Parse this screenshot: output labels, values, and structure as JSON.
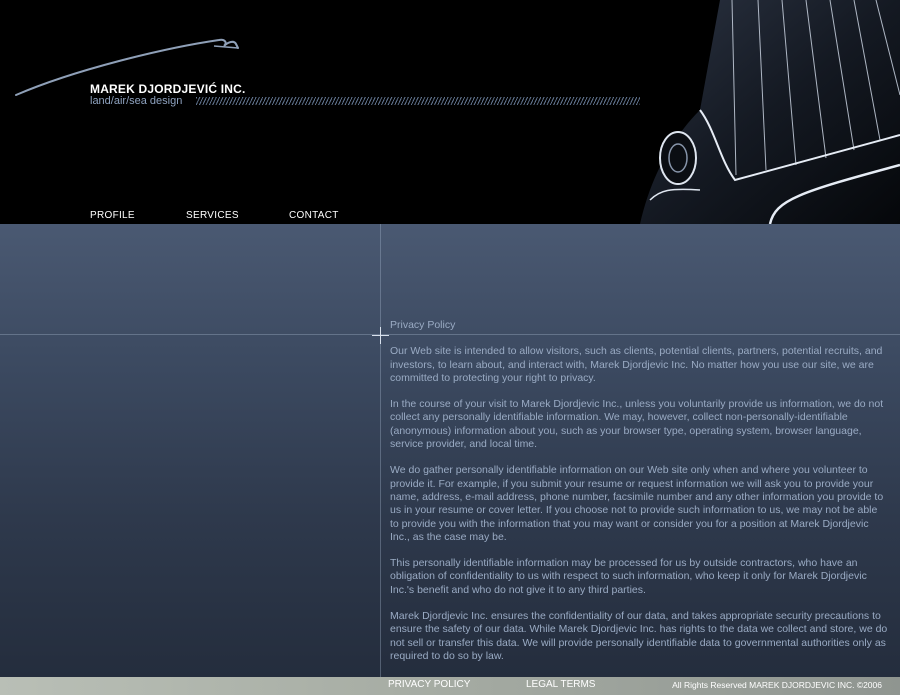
{
  "brand": {
    "name": "MAREK DJORDJEVIĆ INC.",
    "tagline": "land/air/sea design"
  },
  "nav": {
    "items": [
      {
        "label": "PROFILE"
      },
      {
        "label": "SERVICES"
      },
      {
        "label": "CONTACT"
      }
    ]
  },
  "privacy": {
    "title": "Privacy Policy",
    "paragraphs": [
      "Our Web site is intended to allow visitors, such as clients, potential clients, partners, potential recruits, and investors, to learn about, and interact with, Marek Djordjevic Inc. No matter how you use our site, we are committed to protecting your right to privacy.",
      "In the course of your visit to Marek Djordjevic Inc., unless you voluntarily provide us information, we do not collect any personally identifiable information. We may, however, collect non-personally-identifiable (anonymous) information about you, such as your browser type, operating system, browser language, service provider, and local time.",
      "We do gather personally identifiable information on our Web site only when and where you volunteer to provide it. For example, if you submit your resume or request information we will ask you to provide your name, address, e-mail address, phone number, facsimile number and any other information you provide to us in your resume or cover letter. If you choose not to provide such information to us, we may not be able to provide you with the information that you may want or consider you for a position at Marek Djordjevic Inc., as the case may be.",
      "This personally identifiable information may be processed for us by outside contractors, who have an obligation of confidentiality to us with respect to such information, who keep it only for Marek Djordjevic Inc.'s benefit and who do not give it to any third parties.",
      "Marek Djordjevic Inc. ensures the confidentiality of our data, and takes appropriate security precautions to ensure the safety of our data. While Marek Djordjevic Inc. has rights to the data we collect and store, we do not sell or transfer this data. We will provide personally identifiable data to governmental authorities only as required to do so by law."
    ]
  },
  "footer": {
    "privacy_label": "PRIVACY POLICY",
    "legal_label": "LEGAL TERMS",
    "copyright": "All Rights Reserved MAREK DJORDJEVIC INC. ©2006"
  },
  "colors": {
    "accent_text": "#9aabc4",
    "main_bg_top": "#4a5972",
    "main_bg_bottom": "#242d3d"
  }
}
